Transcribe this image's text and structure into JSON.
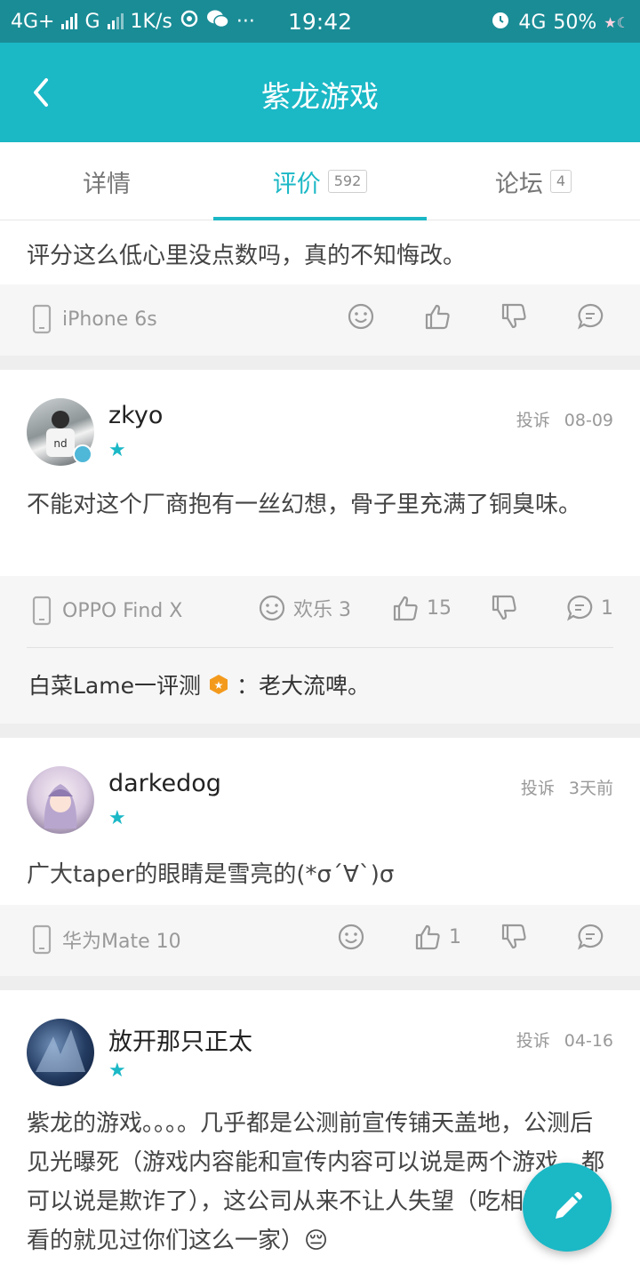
{
  "status_bar": {
    "network_left": "4G+",
    "network_g": "G",
    "speed": "1K/s",
    "more": "···",
    "time": "19:42",
    "network_right": "4G",
    "battery": "50%"
  },
  "app_bar": {
    "title": "紫龙游戏"
  },
  "tabs": [
    {
      "label": "详情",
      "count": ""
    },
    {
      "label": "评价",
      "count": "592"
    },
    {
      "label": "论坛",
      "count": "4"
    }
  ],
  "reviews": [
    {
      "text": "评分这么低心里没点数吗，真的不知悔改。",
      "device": "iPhone 6s",
      "happy": "",
      "likes": "",
      "comments": ""
    },
    {
      "username": "zkyo",
      "stars": "★",
      "report": "投诉",
      "date": "08-09",
      "text": "不能对这个厂商抱有一丝幻想，骨子里充满了铜臭味。",
      "device": "OPPO Find X",
      "happy": "欢乐 3",
      "likes": "15",
      "comments": "1",
      "reply_user": "白菜Lame一评测",
      "reply_text": "：老大流啤。"
    },
    {
      "username": "darkedog",
      "stars": "★",
      "report": "投诉",
      "date": "3天前",
      "text": "广大taper的眼睛是雪亮的(*σ´∀`)σ",
      "device": "华为Mate 10",
      "happy": "",
      "likes": "1",
      "comments": ""
    },
    {
      "username": "放开那只正太",
      "stars": "★",
      "report": "投诉",
      "date": "04-16",
      "text": "紫龙的游戏。。。。几乎都是公测前宣传铺天盖地，公测后见光曝死（游戏内容能和宣传内容可以说是两个游戏，都可以说是欺诈了），这公司从来不让人失望（吃相这么难看的就见过你们这么一家）😔"
    }
  ]
}
